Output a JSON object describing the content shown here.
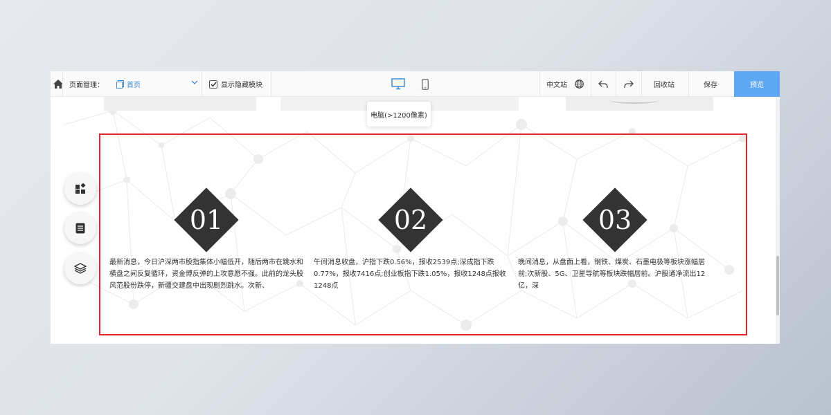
{
  "toolbar": {
    "page_manager_label": "页面管理：",
    "current_page": "首页",
    "show_hidden_label": "显示隐藏模块",
    "language": "中文站",
    "recycle_bin": "回收站",
    "save": "保存",
    "preview": "预览",
    "icons": [
      "home-icon",
      "page-icon",
      "chevron-down-icon",
      "checkbox-checked-icon",
      "desktop-icon",
      "mobile-icon",
      "globe-icon",
      "undo-icon",
      "redo-icon"
    ]
  },
  "tooltip": {
    "text": "电脑(>1200像素)"
  },
  "float_buttons": [
    "widgets-icon",
    "document-icon",
    "layers-icon"
  ],
  "columns": [
    {
      "number": "01",
      "text": "最新消息，今日沪深两市股指集体小幅低开，随后两市在跳水和横盘之间反复循环，资金博反弹的上攻意愿不强。此前的龙头股风范股份跌停，新疆交建盘中出现剧烈跳水。次新、"
    },
    {
      "number": "02",
      "text": "午间消息收盘，沪指下跌0.56%，报收2539点;深成指下跌0.77%，报收7416点;创业板指下跌1.05%，报收1248点报收1248点"
    },
    {
      "number": "03",
      "text": "晚间消息，从盘面上看，钢铁、煤炭、石墨电极等板块涨幅居前;次新股、5G、卫星导航等板块跌幅居前。沪股通净流出12亿，深"
    }
  ],
  "colors": {
    "accent": "#5ea8f3",
    "link": "#3d8bd8",
    "selection_border": "#e0262b",
    "diamond": "#333333"
  }
}
